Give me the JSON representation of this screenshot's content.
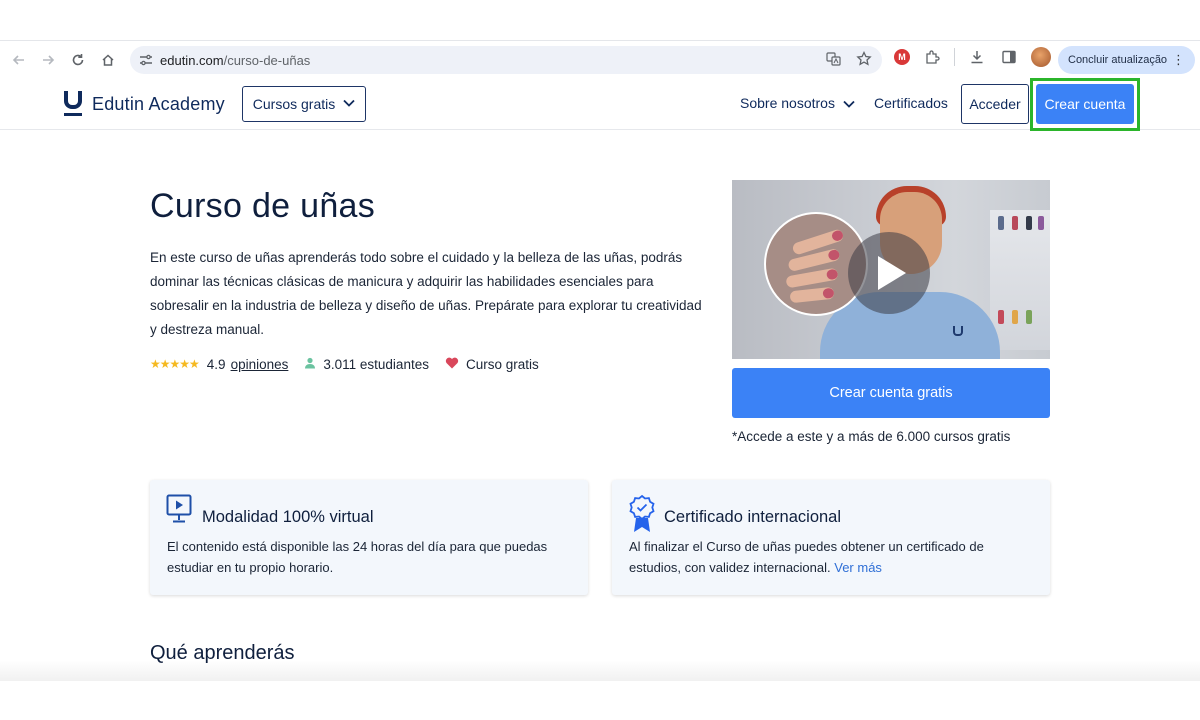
{
  "browser": {
    "url_domain": "edutin.com",
    "url_path": "/curso-de-uñas",
    "update_button": "Concluir atualização"
  },
  "header": {
    "logo_text": "Edutin Academy",
    "courses_button": "Cursos gratis",
    "menu_about": "Sobre nosotros",
    "menu_certificates": "Certificados",
    "login_button": "Acceder",
    "signup_button": "Crear cuenta"
  },
  "hero": {
    "title": "Curso de uñas",
    "description": "En este curso de uñas aprenderás todo sobre el cuidado y la belleza de las uñas, podrás dominar las técnicas clásicas de manicura y adquirir las habilidades esenciales para sobresalir en la industria de belleza y diseño de uñas. Prepárate para explorar tu creatividad y destreza manual.",
    "stars": "★★★★★",
    "rating": "4.9",
    "reviews_link": "opiniones",
    "students": "3.011 estudiantes",
    "price_label": "Curso gratis",
    "cta_button": "Crear cuenta gratis",
    "cta_note": "*Accede a este y a más de 6.000 cursos gratis"
  },
  "features": [
    {
      "title": "Modalidad 100% virtual",
      "text": "El contenido está disponible las 24 horas del día para que puedas estudiar en tu propio horario.",
      "icon": "monitor-play-icon"
    },
    {
      "title": "Certificado internacional",
      "text": "Al finalizar el Curso de uñas puedes obtener un certificado de estudios, con validez internacional.",
      "link": "Ver más",
      "icon": "award-badge-icon"
    }
  ],
  "section": {
    "learn_title": "Qué aprenderás"
  },
  "colors": {
    "primary": "#3b82f6",
    "navy": "#0f2a5c",
    "highlight": "#2bb52b",
    "star": "#f5b921"
  }
}
